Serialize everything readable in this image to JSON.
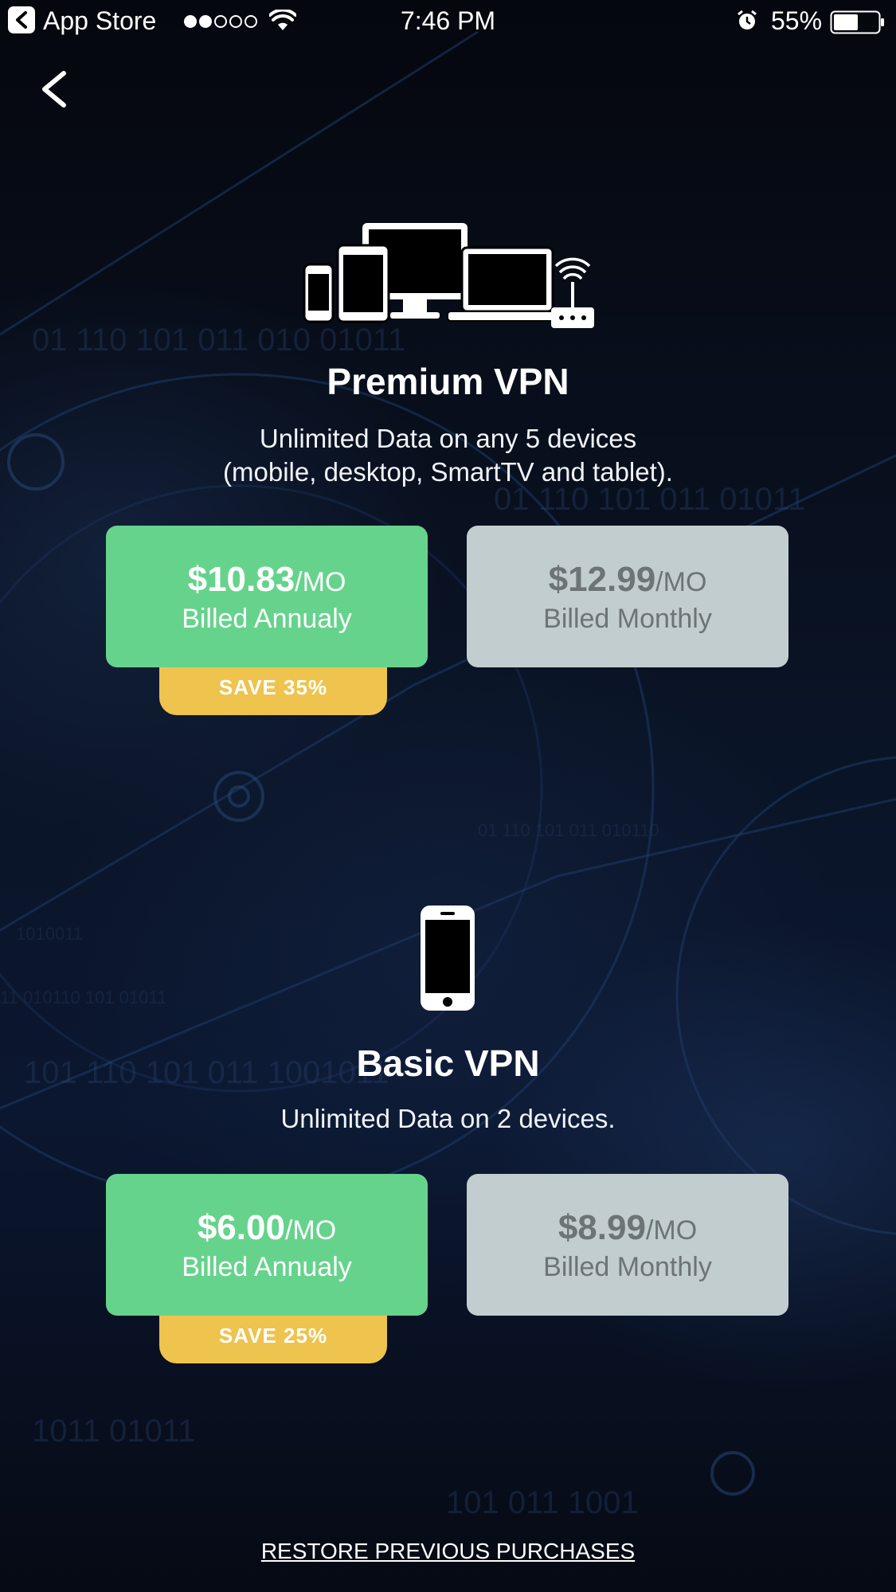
{
  "status_bar": {
    "back_app": "App Store",
    "time": "7:46 PM",
    "battery_percent": "55%",
    "signal_bars_filled": 2,
    "signal_bars_total": 5,
    "battery_level": 0.55
  },
  "icons": {
    "back": "chevron-left-icon",
    "premium_devices": "multi-device-icon",
    "router": "router-wifi-icon",
    "basic_device": "smartphone-icon"
  },
  "plans": [
    {
      "title": "Premium VPN",
      "description_line1": "Unlimited Data on any 5 devices",
      "description_line2": "(mobile, desktop, SmartTV and tablet).",
      "annual": {
        "price": "$10.83",
        "unit": "/MO",
        "billing": "Billed Annualy",
        "badge": "SAVE 35%"
      },
      "monthly": {
        "price": "$12.99",
        "unit": "/MO",
        "billing": "Billed Monthly"
      }
    },
    {
      "title": "Basic VPN",
      "description_line1": "Unlimited Data on 2 devices.",
      "annual": {
        "price": "$6.00",
        "unit": "/MO",
        "billing": "Billed Annualy",
        "badge": "SAVE 25%"
      },
      "monthly": {
        "price": "$8.99",
        "unit": "/MO",
        "billing": "Billed Monthly"
      }
    }
  ],
  "footer": {
    "restore_label": "RESTORE PREVIOUS PURCHASES"
  },
  "colors": {
    "annual_card": "#66d38c",
    "monthly_card": "#c2cdcf",
    "save_badge": "#eec34e",
    "background": "#070b16"
  }
}
